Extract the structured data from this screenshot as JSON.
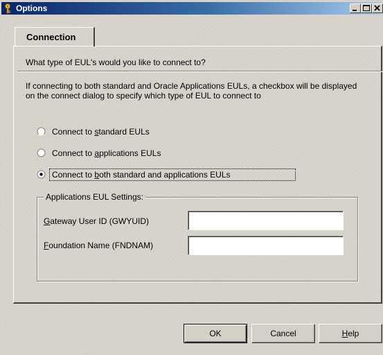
{
  "window": {
    "title": "Options",
    "controls": {
      "minimize": "minimize",
      "maximize": "maximize",
      "close": "close"
    }
  },
  "tabs": [
    {
      "label": "Connection",
      "selected": true
    }
  ],
  "connection": {
    "question": "What type of EUL's would you like to connect to?",
    "description": "If connecting to both standard and Oracle Applications EULs, a checkbox will be displayed on the connect dialog to specify which type of EUL to connect to",
    "options": [
      {
        "label_pre": "Connect to ",
        "mnemonic": "s",
        "label_post": "tandard EULs",
        "selected": false
      },
      {
        "label_pre": "Connect to ",
        "mnemonic": "a",
        "label_post": "pplications EULs",
        "selected": false
      },
      {
        "label_pre": "Connect to ",
        "mnemonic": "b",
        "label_post": "oth standard and applications EULs",
        "selected": true
      }
    ],
    "settings": {
      "legend": "Applications EUL Settings:",
      "gateway": {
        "mnemonic": "G",
        "label_rest": "ateway User ID (GWYUID)",
        "value": ""
      },
      "foundation": {
        "mnemonic": "F",
        "label_rest": "oundation Name (FNDNAM)",
        "value": ""
      }
    }
  },
  "buttons": {
    "ok": "OK",
    "cancel": "Cancel",
    "help_mnemonic": "H",
    "help_rest": "elp"
  },
  "colors": {
    "titlebar_start": "#0a246a",
    "titlebar_end": "#a6caf0",
    "face": "#d4d0c8"
  }
}
